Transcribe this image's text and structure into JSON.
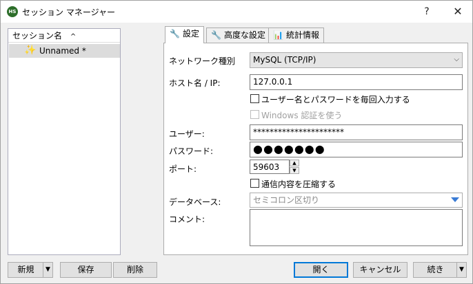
{
  "window": {
    "title": "セッション マネージャー",
    "app_icon_text": "HS",
    "help_label": "?",
    "close_label": "✕"
  },
  "sessions": {
    "column_header": "セッション名",
    "sort_indicator": "^",
    "items": [
      {
        "label": "Unnamed *",
        "icon": "star-icon",
        "selected": true
      }
    ]
  },
  "tabs": [
    {
      "label": "設定",
      "icon": "wrench-icon",
      "active": true
    },
    {
      "label": "高度な設定",
      "icon": "wrench-icon",
      "active": false
    },
    {
      "label": "統計情報",
      "icon": "bar-chart-icon",
      "active": false
    }
  ],
  "settings": {
    "network_type": {
      "label": "ネットワーク種別",
      "value": "MySQL (TCP/IP)"
    },
    "host": {
      "label": "ホスト名 / IP:",
      "value": "127.0.0.1"
    },
    "prompt_credentials": {
      "label": "ユーザー名とパスワードを毎回入力する",
      "checked": false
    },
    "windows_auth": {
      "label": "Windows 認証を使う",
      "checked": false,
      "disabled": true
    },
    "user": {
      "label": "ユーザー:",
      "value": "**********************"
    },
    "password": {
      "label": "パスワード:",
      "value": "●●●●●●●"
    },
    "port": {
      "label": "ポート:",
      "value": "59603"
    },
    "compression": {
      "label": "通信内容を圧縮する",
      "checked": false
    },
    "databases": {
      "label": "データベース:",
      "placeholder": "セミコロン区切り"
    },
    "comment": {
      "label": "コメント:",
      "value": ""
    }
  },
  "buttons": {
    "new": "新規",
    "save": "保存",
    "delete": "削除",
    "open": "開く",
    "cancel": "キャンセル",
    "more": "続き",
    "dropdown_arrow": "▼"
  },
  "colors": {
    "accent": "#0078d7",
    "selection": "#dcdcdc",
    "dropdown_triangle": "#3a7bd5"
  }
}
